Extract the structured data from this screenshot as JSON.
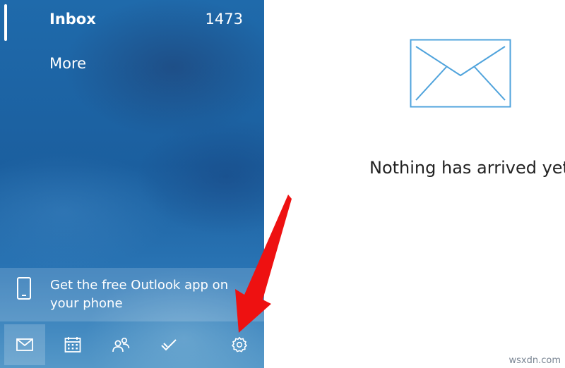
{
  "sidebar": {
    "folders": [
      {
        "label": "Inbox",
        "count": "1473"
      },
      {
        "label": "More"
      }
    ],
    "promo": {
      "text": "Get the free Outlook app on your phone",
      "icon": "phone-icon"
    },
    "nav": [
      {
        "icon": "mail-icon",
        "active": true
      },
      {
        "icon": "calendar-icon"
      },
      {
        "icon": "people-icon"
      },
      {
        "icon": "todo-icon"
      },
      {
        "icon": "settings-gear-icon"
      }
    ]
  },
  "content": {
    "empty_message": "Nothing has arrived yet",
    "icon": "envelope-icon"
  },
  "annotation": {
    "color": "#ee1111"
  },
  "watermark": "wsxdn.com"
}
